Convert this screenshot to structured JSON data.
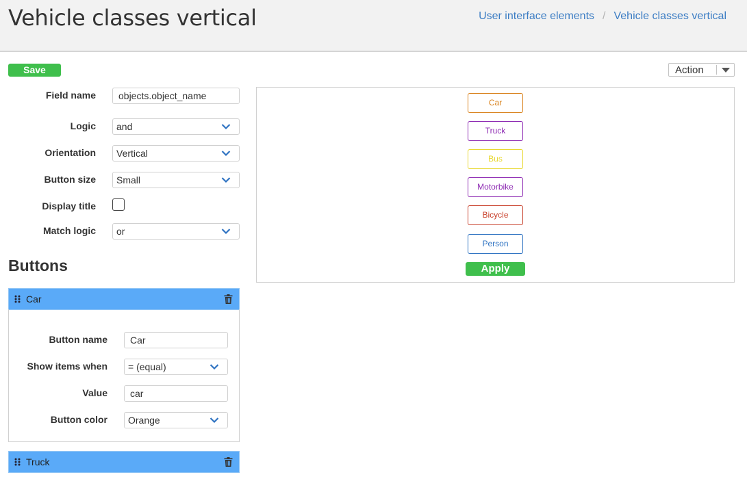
{
  "header": {
    "title": "Vehicle classes vertical",
    "breadcrumb": [
      "User interface elements",
      "Vehicle classes vertical"
    ]
  },
  "toolbar": {
    "save_label": "Save",
    "action_label": "Action"
  },
  "form": {
    "field_name": {
      "label": "Field name",
      "value": "objects.object_name"
    },
    "logic": {
      "label": "Logic",
      "value": "and"
    },
    "orientation": {
      "label": "Orientation",
      "value": "Vertical"
    },
    "button_size": {
      "label": "Button size",
      "value": "Small"
    },
    "display_title": {
      "label": "Display title",
      "checked": false
    },
    "match_logic": {
      "label": "Match logic",
      "value": "or"
    }
  },
  "buttons_section": {
    "title": "Buttons",
    "panels": [
      {
        "name": "Car",
        "expanded": true,
        "button_name": {
          "label": "Button name",
          "value": "Car"
        },
        "show_items_when": {
          "label": "Show items when",
          "value": "= (equal)"
        },
        "value": {
          "label": "Value",
          "value": "car"
        },
        "button_color": {
          "label": "Button color",
          "value": "Orange"
        }
      },
      {
        "name": "Truck",
        "expanded": false
      }
    ]
  },
  "preview": {
    "buttons": [
      {
        "label": "Car",
        "color": "#d9821c"
      },
      {
        "label": "Truck",
        "color": "#8e2bb3"
      },
      {
        "label": "Bus",
        "color": "#e8d830"
      },
      {
        "label": "Motorbike",
        "color": "#8e2bb3"
      },
      {
        "label": "Bicycle",
        "color": "#c9422d"
      },
      {
        "label": "Person",
        "color": "#2f73c2"
      }
    ],
    "apply_label": "Apply"
  },
  "colors": {
    "accent_green": "#3fbf4c",
    "panel_blue": "#5aaaf8",
    "link_blue": "#3c7dc4"
  }
}
